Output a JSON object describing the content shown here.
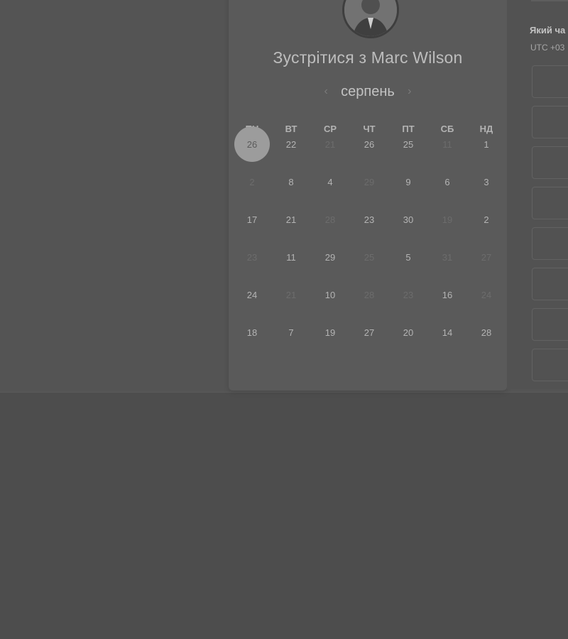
{
  "scheduler": {
    "title": "Зустрітися з Marc Wilson",
    "month": "серпень",
    "prev_icon": "chevron-left-icon",
    "next_icon": "chevron-right-icon",
    "weekdays": [
      "ПН",
      "ВТ",
      "СР",
      "ЧТ",
      "ПТ",
      "СБ",
      "НД"
    ],
    "weeks": [
      [
        {
          "d": "26",
          "state": "selected"
        },
        {
          "d": "22",
          "state": "available"
        },
        {
          "d": "21",
          "state": "disabled"
        },
        {
          "d": "26",
          "state": "available"
        },
        {
          "d": "25",
          "state": "available"
        },
        {
          "d": "11",
          "state": "disabled"
        },
        {
          "d": "1",
          "state": "available"
        }
      ],
      [
        {
          "d": "2",
          "state": "disabled"
        },
        {
          "d": "8",
          "state": "available"
        },
        {
          "d": "4",
          "state": "available"
        },
        {
          "d": "29",
          "state": "disabled"
        },
        {
          "d": "9",
          "state": "available"
        },
        {
          "d": "6",
          "state": "available"
        },
        {
          "d": "3",
          "state": "available"
        }
      ],
      [
        {
          "d": "17",
          "state": "available"
        },
        {
          "d": "21",
          "state": "available"
        },
        {
          "d": "28",
          "state": "disabled"
        },
        {
          "d": "23",
          "state": "available"
        },
        {
          "d": "30",
          "state": "available"
        },
        {
          "d": "19",
          "state": "disabled"
        },
        {
          "d": "2",
          "state": "available"
        }
      ],
      [
        {
          "d": "23",
          "state": "disabled"
        },
        {
          "d": "11",
          "state": "available"
        },
        {
          "d": "29",
          "state": "available"
        },
        {
          "d": "25",
          "state": "disabled"
        },
        {
          "d": "5",
          "state": "available"
        },
        {
          "d": "31",
          "state": "disabled"
        },
        {
          "d": "27",
          "state": "disabled"
        }
      ],
      [
        {
          "d": "24",
          "state": "available"
        },
        {
          "d": "21",
          "state": "disabled"
        },
        {
          "d": "10",
          "state": "available"
        },
        {
          "d": "28",
          "state": "disabled"
        },
        {
          "d": "23",
          "state": "disabled"
        },
        {
          "d": "16",
          "state": "available"
        },
        {
          "d": "24",
          "state": "disabled"
        }
      ],
      [
        {
          "d": "18",
          "state": "available"
        },
        {
          "d": "7",
          "state": "available"
        },
        {
          "d": "19",
          "state": "available"
        },
        {
          "d": "27",
          "state": "available"
        },
        {
          "d": "20",
          "state": "available"
        },
        {
          "d": "14",
          "state": "available"
        },
        {
          "d": "28",
          "state": "available"
        }
      ]
    ]
  },
  "time_panel": {
    "heading": "Який ча",
    "timezone": "UTC +03"
  }
}
